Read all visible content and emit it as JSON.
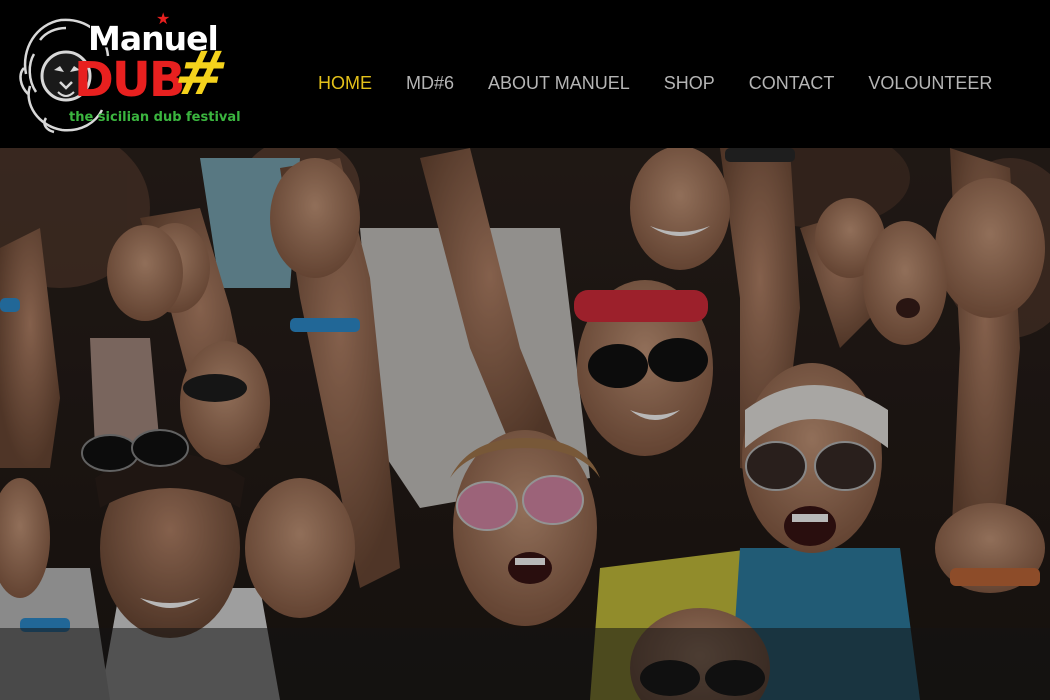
{
  "logo": {
    "title": "Manuel",
    "dub": "DUB",
    "hash": "#",
    "tagline": "the sicilian dub festival",
    "colors": {
      "red": "#e8201f",
      "yellow": "#f4d21c",
      "green": "#3bb53f"
    }
  },
  "nav": {
    "items": [
      {
        "label": "HOME",
        "active": true
      },
      {
        "label": "MD#6",
        "active": false
      },
      {
        "label": "ABOUT MANUEL",
        "active": false
      },
      {
        "label": "SHOP",
        "active": false
      },
      {
        "label": "CONTACT",
        "active": false
      },
      {
        "label": "VOLOUNTEER",
        "active": false
      }
    ],
    "active_color": "#e3c11a",
    "color": "#b5b5b5"
  },
  "hero": {
    "image": "festival-crowd-photo"
  }
}
